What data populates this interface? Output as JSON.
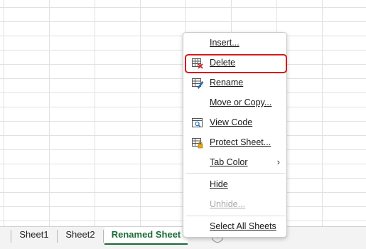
{
  "sheet_tabs": [
    {
      "label": "Sheet1"
    },
    {
      "label": "Sheet2"
    },
    {
      "label": "Renamed Sheet"
    }
  ],
  "context_menu": {
    "items": [
      {
        "label": "Insert...",
        "icon": null
      },
      {
        "label": "Delete",
        "icon": "delete-sheet-icon",
        "highlighted": true
      },
      {
        "label": "Rename",
        "icon": "rename-sheet-icon"
      },
      {
        "label": "Move or Copy...",
        "icon": null
      },
      {
        "label": "View Code",
        "icon": "view-code-icon"
      },
      {
        "label": "Protect Sheet...",
        "icon": "protect-sheet-icon"
      },
      {
        "label": "Tab Color",
        "icon": null,
        "submenu": true
      },
      {
        "label": "Hide",
        "icon": null
      },
      {
        "label": "Unhide...",
        "icon": null,
        "disabled": true
      },
      {
        "label": "Select All Sheets",
        "icon": null
      }
    ]
  },
  "colors": {
    "active_tab_text": "#1d6b3a",
    "highlight_border": "#d51a1a",
    "gridline": "#e1e1e1"
  }
}
